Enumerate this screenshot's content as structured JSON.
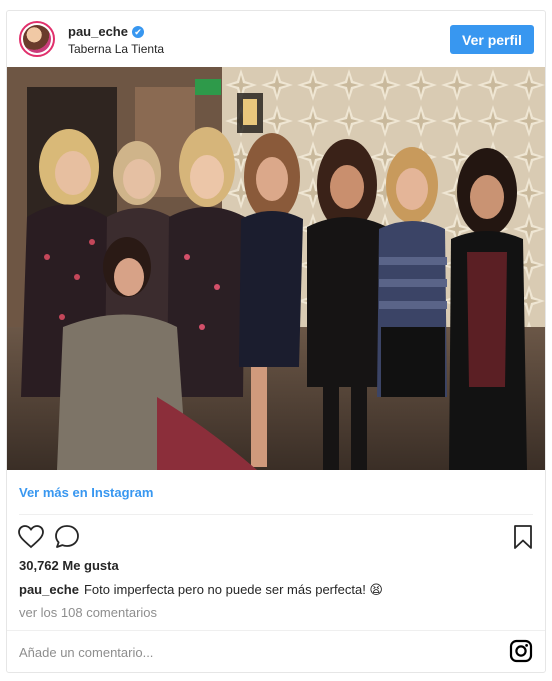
{
  "post": {
    "username": "pau_eche",
    "verified_mark": "✔",
    "location": "Taberna La Tienta",
    "follow_button": "Ver perfil",
    "photo_icon": "group-photo",
    "more_link": "Ver más en Instagram",
    "likes": "30,762 Me gusta",
    "caption_user": "pau_eche",
    "caption_text": "Foto imperfecta pero no puede ser más perfecta! 😫",
    "view_comments": "ver los 108 comentarios",
    "comment_placeholder": "Añade un comentario..."
  },
  "icons": {
    "like": "heart-icon",
    "comment": "comment-icon",
    "save": "bookmark-icon",
    "instagram": "instagram-logo-icon"
  },
  "colors": {
    "accent": "#3897f0",
    "text": "#262626",
    "muted": "#8e8e8e",
    "border": "#e6e6e6"
  }
}
